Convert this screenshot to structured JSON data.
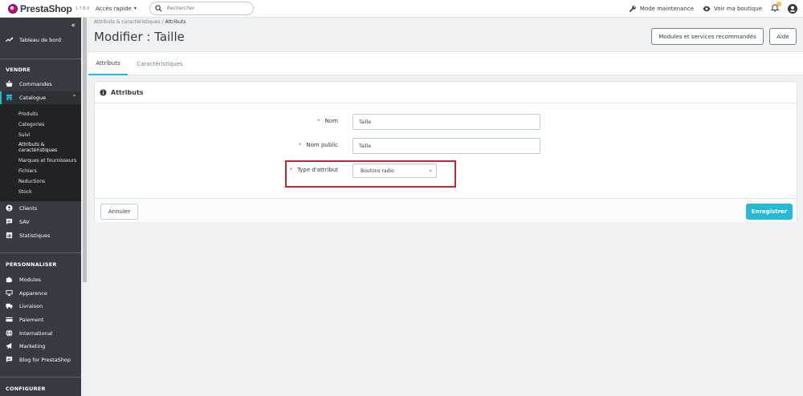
{
  "header": {
    "logo_text": "PrestaShop",
    "version": "1.7.8.0",
    "quick_access": "Accès rapide",
    "search_placeholder": "Rechercher",
    "maintenance": "Mode maintenance",
    "view_shop": "Voir ma boutique",
    "notification_count": "1",
    "colors": {
      "accent": "#25b9d7",
      "brand_pink": "#df0067",
      "highlight_red": "#c1272d"
    }
  },
  "sidebar": {
    "collapse_icon": "double-chevron-left-icon",
    "dashboard": "Tableau de bord",
    "section_sell": "VENDRE",
    "orders": "Commandes",
    "catalog": "Catalogue",
    "catalog_sub": [
      "Produits",
      "Categories",
      "Suivi",
      "Attributs & caractéristiques",
      "Marques et fournisseurs",
      "Fichiers",
      "Reductions",
      "Stock"
    ],
    "customers": "Clients",
    "sav": "SAV",
    "stats": "Statistiques",
    "section_customize": "PERSONNALISER",
    "modules": "Modules",
    "appearance": "Apparence",
    "shipping": "Livraison",
    "payment": "Paiement",
    "international": "International",
    "marketing": "Marketing",
    "blog": "Blog for PrestaShop",
    "section_configure": "CONFIGURER"
  },
  "main": {
    "breadcrumb_parent": "Attributs & caractéristiques",
    "breadcrumb_current": "Attributs",
    "title": "Modifier : Taille",
    "btn_modules": "Modules et services recommandés",
    "btn_help": "Aide",
    "tabs": [
      "Attributs",
      "Caractéristiques"
    ],
    "panel_title": "Attributs",
    "fields": {
      "name_label": "Nom",
      "name_value": "Taille",
      "public_label": "Nom public",
      "public_value": "Taille",
      "type_label": "Type d'attribut",
      "type_value": "Boutons radio"
    },
    "required_mark": "*",
    "btn_cancel": "Annuler",
    "btn_save": "Enregistrer"
  }
}
